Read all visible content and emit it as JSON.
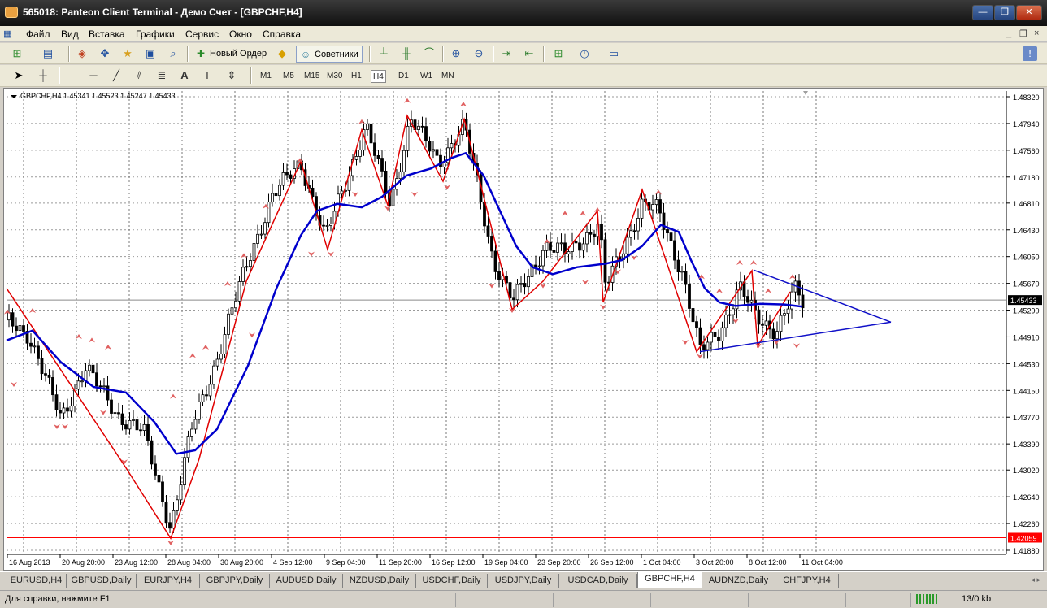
{
  "window": {
    "title": "565018: Panteon Client Terminal - Демо Счет - [GBPCHF,H4]",
    "min_glyph": "—",
    "max_glyph": "❐",
    "close_glyph": "✕"
  },
  "menu": {
    "items": [
      "Файл",
      "Вид",
      "Вставка",
      "Графики",
      "Сервис",
      "Окно",
      "Справка"
    ],
    "mdi_glyphs": [
      "_",
      "❐",
      "×"
    ]
  },
  "toolbar": {
    "new_order_label": "Новый Ордер",
    "signals_label": "Советники",
    "timeframes": [
      "M1",
      "M5",
      "M15",
      "M30",
      "H1",
      "H4",
      "D1",
      "W1",
      "MN"
    ],
    "active_timeframe": "H4"
  },
  "chart": {
    "header": "GBPCHF,H4  1.45341 1.45523 1.45247 1.45433",
    "current_price_label": "1.45433",
    "red_line_label": "1.42059",
    "price_ticks": [
      "1.48320",
      "1.47940",
      "1.47560",
      "1.47180",
      "1.46810",
      "1.46430",
      "1.46050",
      "1.45670",
      "1.45290",
      "1.44910",
      "1.44530",
      "1.44150",
      "1.43770",
      "1.43390",
      "1.43020",
      "1.42640",
      "1.42260",
      "1.41880"
    ],
    "time_ticks": [
      "16 Aug 2013",
      "20 Aug 20:00",
      "23 Aug 12:00",
      "28 Aug 04:00",
      "30 Aug 20:00",
      "4 Sep 12:00",
      "9 Sep 04:00",
      "11 Sep 20:00",
      "16 Sep 12:00",
      "19 Sep 04:00",
      "23 Sep 20:00",
      "26 Sep 12:00",
      "1 Oct 04:00",
      "3 Oct 20:00",
      "8 Oct 12:00",
      "11 Oct 04:00"
    ],
    "colors": {
      "background": "#ffffff",
      "candles": "#000000",
      "zigzag": "#e00000",
      "moving_average": "#0000cc",
      "triangle": "#1010c8",
      "fractals": "#e06060",
      "red_level": "#ff0000"
    }
  },
  "tabs": {
    "items": [
      "EURUSD,H4",
      "GBPUSD,Daily",
      "EURJPY,H4",
      "GBPJPY,Daily",
      "AUDUSD,Daily",
      "NZDUSD,Daily",
      "USDCHF,Daily",
      "USDJPY,Daily",
      "USDCAD,Daily",
      "GBPCHF,H4",
      "AUDNZD,Daily",
      "CHFJPY,H4"
    ],
    "active": "GBPCHF,H4",
    "scroll_glyph": "◂ ▸"
  },
  "status": {
    "help_text": "Для справки, нажмите F1",
    "traffic": "13/0 kb"
  }
}
